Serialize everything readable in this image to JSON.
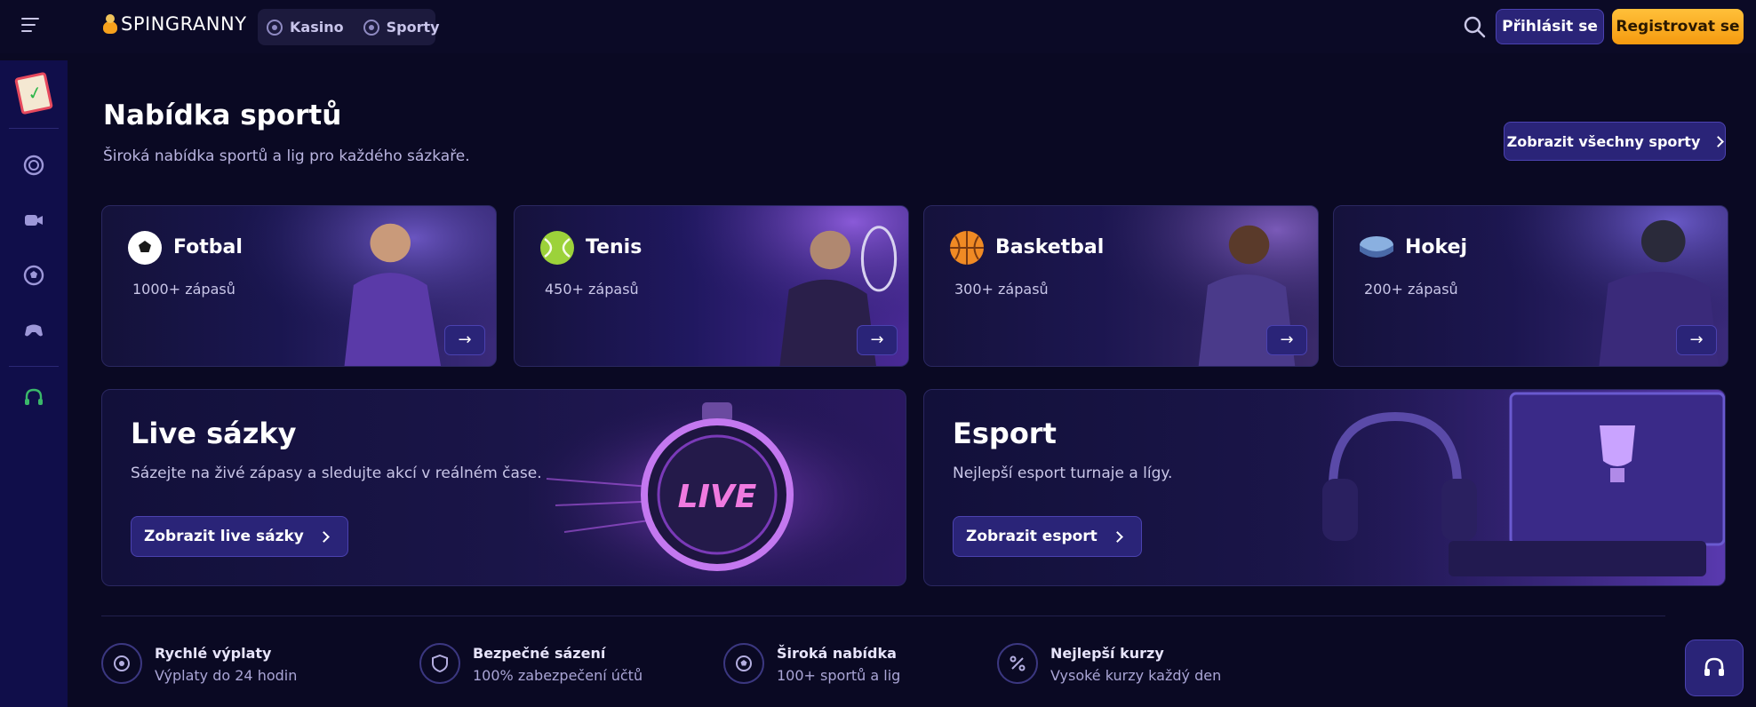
{
  "header": {
    "logo_text": "SPINGRANNY",
    "mode_tabs": [
      {
        "label": "Kasino",
        "icon": "casino-chip-icon"
      },
      {
        "label": "Sporty",
        "icon": "soccer-ball-icon"
      }
    ],
    "login_label": "Přihlásit se",
    "register_label": "Registrovat se"
  },
  "sidebar": {
    "items": [
      {
        "icon": "promotions-clipboard-icon"
      },
      {
        "icon": "casino-chip-icon"
      },
      {
        "icon": "live-camera-icon"
      },
      {
        "icon": "soccer-ball-icon"
      },
      {
        "icon": "esport-gamepad-icon"
      },
      {
        "icon": "support-headset-icon"
      }
    ]
  },
  "main": {
    "title": "Nabídka sportů",
    "subtitle": "Široká nabídka sportů a lig pro každého sázkaře.",
    "all_sports_label": "Zobrazit všechny sporty",
    "sports": [
      {
        "name": "Fotbal",
        "count": "1000+ zápasů",
        "icon": "soccer-ball-icon"
      },
      {
        "name": "Tenis",
        "count": "450+ zápasů",
        "icon": "tennis-ball-icon"
      },
      {
        "name": "Basketbal",
        "count": "300+ zápasů",
        "icon": "basketball-icon"
      },
      {
        "name": "Hokej",
        "count": "200+ zápasů",
        "icon": "hockey-puck-icon"
      }
    ],
    "live": {
      "title": "Live sázky",
      "subtitle": "Sázejte na živé zápasy a sledujte akcí v reálném čase.",
      "button": "Zobrazit live sázky",
      "badge": "LIVE"
    },
    "esport": {
      "title": "Esport",
      "subtitle": "Nejlepší esport turnaje a lígy.",
      "button": "Zobrazit esport"
    },
    "features": [
      {
        "title": "Rychlé výplaty",
        "sub": "Výplaty do 24 hodin",
        "icon": "payout-coin-icon"
      },
      {
        "title": "Bezpečné sázení",
        "sub": "100% zabezpečení účtů",
        "icon": "shield-icon"
      },
      {
        "title": "Široká nabídka",
        "sub": "100+ sportů a lig",
        "icon": "soccer-ball-icon"
      },
      {
        "title": "Nejlepší kurzy",
        "sub": "Vysoké kurzy každý den",
        "icon": "odds-icon"
      }
    ]
  },
  "colors": {
    "background": "#0a0923",
    "sidebar": "#100e4a",
    "accent_button": "#2a2478",
    "register_button": "#f7a81b"
  }
}
